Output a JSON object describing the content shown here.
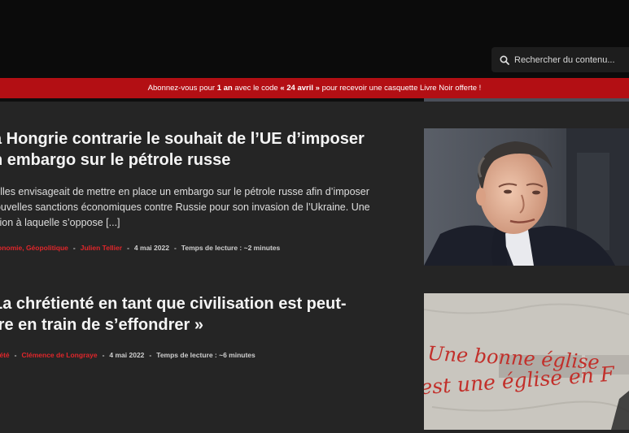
{
  "search": {
    "placeholder": "Rechercher du contenu..."
  },
  "promo": {
    "part1": "Abonnez-vous pour ",
    "bold1": "1 an",
    "part2": " avec le code ",
    "bold2": "« 24 avril »",
    "part3": " pour recevoir une casquette Livre Noir offerte !"
  },
  "articles": [
    {
      "title_line1": "a Hongrie contrarie le souhait de l’UE d’imposer",
      "title_line2": "n embargo sur le pétrole russe",
      "excerpt_line1": "xelles envisageait de mettre en place un embargo sur le pétrole russe afin d’imposer",
      "excerpt_line2": "nouvelles sanctions économiques contre Russie pour son invasion de l’Ukraine. Une",
      "excerpt_line3": "tision à laquelle s’oppose [...]",
      "categories": "onomie, Géopolitique",
      "author": "Julien Tellier",
      "date": "4 mai 2022",
      "read_time": "Temps de lecture : ~2 minutes"
    },
    {
      "title_line1": "La chrétienté en tant que civilisation est peut-",
      "title_line2": "tre en train de s’effondrer »",
      "categories": "iété",
      "author": "Clémence de Longraye",
      "date": "4 mai 2022",
      "read_time": "Temps de lecture : ~6 minutes"
    }
  ],
  "graffiti": {
    "line1": "Une bonne église",
    "line2": "est une église en F"
  },
  "colors": {
    "accent": "#e0262b",
    "promo_bg": "#b30f14",
    "page_bg": "#252525",
    "header_bg": "#0b0b0b"
  }
}
